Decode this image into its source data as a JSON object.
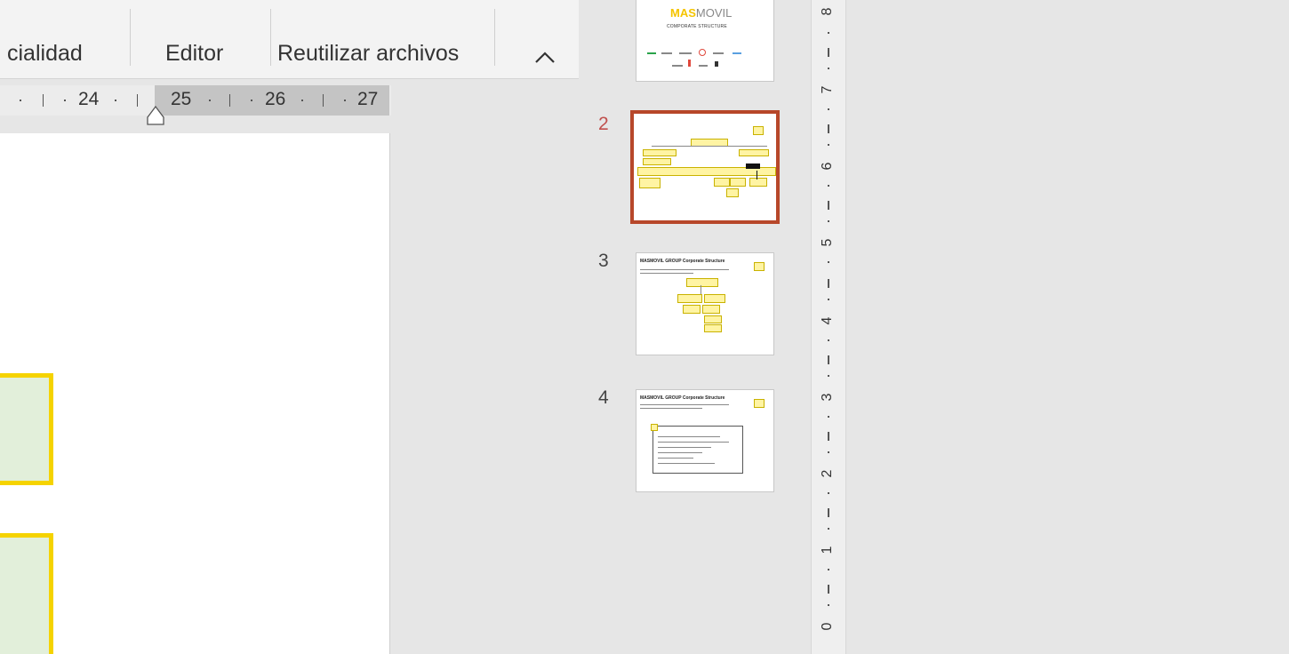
{
  "ribbon": {
    "groups": [
      "cialidad",
      "Editor",
      "Reutilizar archivos"
    ],
    "collapse_icon": "chevron-up-icon"
  },
  "ruler": {
    "labels": [
      "24",
      "25",
      "26",
      "27"
    ]
  },
  "thumbnails": [
    {
      "number": "",
      "brand_bold": "MAS",
      "brand_light": "MOVIL",
      "subtitle": "COMPORATE STRUCTURE"
    },
    {
      "number": "2",
      "selected": true
    },
    {
      "number": "3",
      "title": "MASMOVIL GROUP Corporate Structure"
    },
    {
      "number": "4",
      "title": "MASMOVIL GROUP Corporate Structure"
    }
  ],
  "vertical_ruler": {
    "labels": [
      "8",
      "7",
      "6",
      "5",
      "4",
      "3",
      "2",
      "1",
      "0"
    ]
  },
  "colors": {
    "selection": "#b7472a",
    "shape_fill": "#e2efda",
    "shape_border": "#f5d300",
    "brand_yellow": "#f5c400"
  }
}
